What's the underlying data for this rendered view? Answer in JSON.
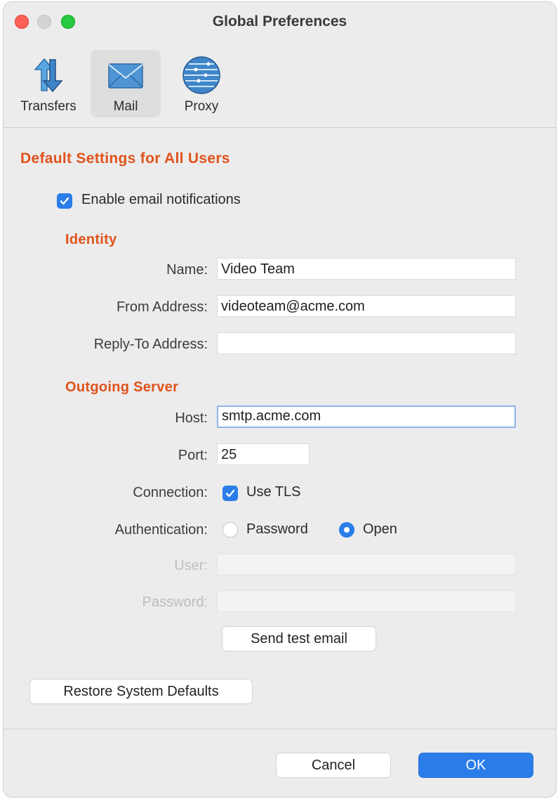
{
  "window": {
    "title": "Global Preferences"
  },
  "toolbar": {
    "tabs": [
      {
        "label": "Transfers",
        "icon": "transfers-arrows-icon"
      },
      {
        "label": "Mail",
        "icon": "mail-envelope-icon",
        "selected": true
      },
      {
        "label": "Proxy",
        "icon": "proxy-globe-icon"
      }
    ]
  },
  "content": {
    "section_title": "Default Settings for All Users",
    "enable_notifications": {
      "label": "Enable email notifications",
      "checked": true
    },
    "identity": {
      "title": "Identity",
      "name_label": "Name:",
      "name_value": "Video Team",
      "from_label": "From Address:",
      "from_value": "videoteam@acme.com",
      "replyto_label": "Reply-To Address:",
      "replyto_value": ""
    },
    "server": {
      "title": "Outgoing Server",
      "host_label": "Host:",
      "host_value": "smtp.acme.com",
      "port_label": "Port:",
      "port_value": "25",
      "connection_label": "Connection:",
      "tls_label": "Use TLS",
      "tls_checked": true,
      "auth_label": "Authentication:",
      "auth_password_label": "Password",
      "auth_open_label": "Open",
      "auth_selected": "Open",
      "user_label": "User:",
      "user_value": "",
      "password_label": "Password:",
      "password_value": "",
      "test_button": "Send test email"
    },
    "restore_button": "Restore System Defaults"
  },
  "footer": {
    "cancel_button": "Cancel",
    "ok_button": "OK"
  },
  "colors": {
    "accent": "#2b7de9",
    "section_title": "#e0531b"
  }
}
